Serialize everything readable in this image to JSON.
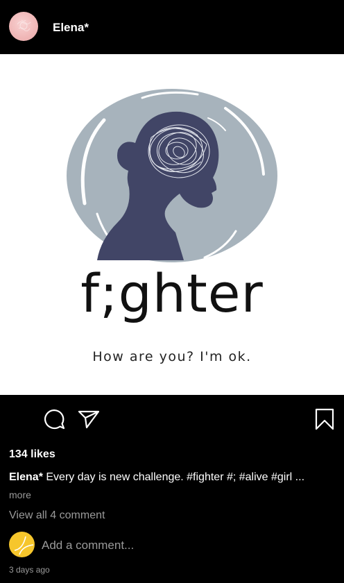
{
  "header": {
    "username": "Elena*",
    "avatar_icon": "profile-avatar"
  },
  "post": {
    "image_title": "f;ghter",
    "image_tagline": "How are you? I'm ok.",
    "colors": {
      "bubble": "#a7b3bc",
      "silhouette": "#414566",
      "scribble": "#e4e7ee"
    }
  },
  "actions": {
    "comment_icon": "comment-icon",
    "share_icon": "send-icon",
    "save_icon": "bookmark-icon"
  },
  "likes": "134 likes",
  "caption": {
    "username": "Elena*",
    "text": "Every day is new challenge. #fighter #; #alive #girl ..."
  },
  "more_label": "more",
  "view_all_label": "View all 4 comment",
  "add_comment_placeholder": "Add a comment...",
  "timestamp": "3 days ago",
  "colors": {
    "background": "#000000",
    "text": "#ffffff",
    "muted": "#9a9a9a",
    "my_avatar": "#f6c62c"
  }
}
